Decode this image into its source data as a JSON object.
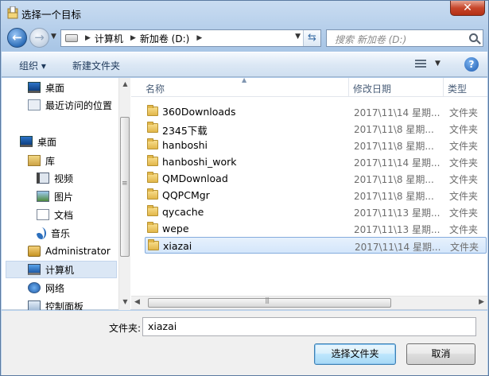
{
  "window": {
    "title": "选择一个目标",
    "close_label": "✕"
  },
  "nav": {
    "back_glyph": "←",
    "forward_glyph": "→",
    "breadcrumb": [
      "计算机",
      "新加卷 (D:)"
    ],
    "search_placeholder": "搜索 新加卷 (D:)"
  },
  "toolbar": {
    "organize_label": "组织 ▾",
    "new_folder_label": "新建文件夹",
    "help_glyph": "?"
  },
  "sidebar": {
    "items": [
      {
        "label": "桌面",
        "icon": "desktop-icon"
      },
      {
        "label": "最近访问的位置",
        "icon": "recent-places-icon"
      },
      {
        "label": "桌面",
        "icon": "desktop-icon"
      },
      {
        "label": "库",
        "icon": "library-icon"
      },
      {
        "label": "视频",
        "icon": "video-icon"
      },
      {
        "label": "图片",
        "icon": "pictures-icon"
      },
      {
        "label": "文档",
        "icon": "documents-icon"
      },
      {
        "label": "音乐",
        "icon": "music-icon"
      },
      {
        "label": "Administrator",
        "icon": "user-folder-icon"
      },
      {
        "label": "计算机",
        "icon": "computer-icon",
        "selected": true
      },
      {
        "label": "网络",
        "icon": "network-icon"
      },
      {
        "label": "控制面板",
        "icon": "control-panel-icon"
      }
    ]
  },
  "columns": {
    "name": "名称",
    "date": "修改日期",
    "type": "类型"
  },
  "files": [
    {
      "name": "360Downloads",
      "date": "2017\\11\\14 星期...",
      "type": "文件夹"
    },
    {
      "name": "2345下载",
      "date": "2017\\11\\8 星期...",
      "type": "文件夹"
    },
    {
      "name": "hanboshi",
      "date": "2017\\11\\8 星期...",
      "type": "文件夹"
    },
    {
      "name": "hanboshi_work",
      "date": "2017\\11\\14 星期...",
      "type": "文件夹"
    },
    {
      "name": "QMDownload",
      "date": "2017\\11\\8 星期...",
      "type": "文件夹"
    },
    {
      "name": "QQPCMgr",
      "date": "2017\\11\\8 星期...",
      "type": "文件夹"
    },
    {
      "name": "qycache",
      "date": "2017\\11\\13 星期...",
      "type": "文件夹"
    },
    {
      "name": "wepe",
      "date": "2017\\11\\13 星期...",
      "type": "文件夹"
    },
    {
      "name": "xiazai",
      "date": "2017\\11\\14 星期...",
      "type": "文件夹",
      "selected": true
    }
  ],
  "footer": {
    "folder_label": "文件夹:",
    "folder_value": "xiazai",
    "select_button": "选择文件夹",
    "cancel_button": "取消"
  }
}
